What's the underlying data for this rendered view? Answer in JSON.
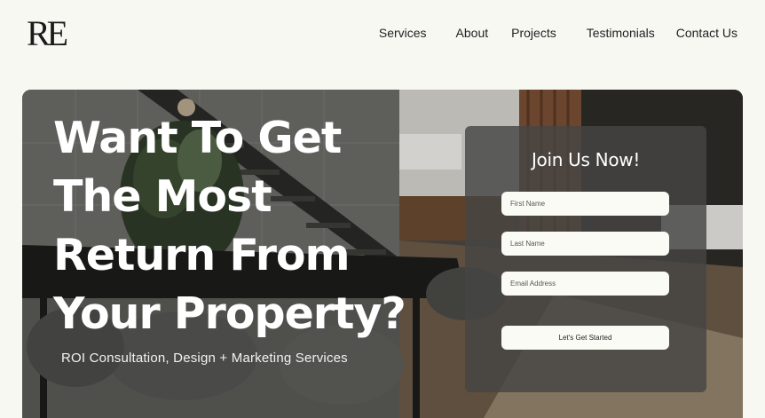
{
  "brand": {
    "logo_text": "RE"
  },
  "nav": {
    "items": [
      {
        "label": "Services"
      },
      {
        "label": "About"
      },
      {
        "label": "Projects"
      },
      {
        "label": "Testimonials"
      },
      {
        "label": "Contact Us"
      }
    ]
  },
  "hero": {
    "headline_lines": [
      "Want To Get",
      "The Most",
      "Return From",
      "Your Property?"
    ],
    "subline": "ROI Consultation, Design + Marketing Services"
  },
  "form": {
    "title": "Join Us Now!",
    "first_name_placeholder": "First Name",
    "last_name_placeholder": "Last Name",
    "email_placeholder": "Email Address",
    "submit_label": "Let's Get Started"
  },
  "colors": {
    "page_bg": "#f8f8f3",
    "panel_bg": "#464644",
    "field_bg": "#fbfbf6",
    "headline": "#ffffff"
  }
}
